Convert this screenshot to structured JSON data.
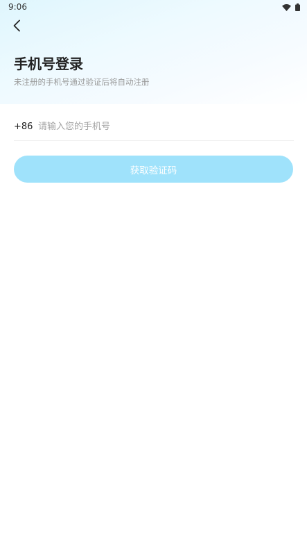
{
  "status_bar": {
    "time": "9:06",
    "icons": [
      "wifi-icon",
      "battery-icon"
    ]
  },
  "header": {
    "back_icon": "chevron-left-icon"
  },
  "login": {
    "title": "手机号登录",
    "subtitle": "未注册的手机号通过验证后将自动注册",
    "country_code": "+86",
    "phone_value": "",
    "phone_placeholder": "请输入您的手机号",
    "submit_label": "获取验证码"
  },
  "colors": {
    "button_bg": "#9fe2fb",
    "button_text": "#ffffff",
    "gradient_top": "#dff6fd",
    "title": "#222222",
    "subtitle": "#999999",
    "divider": "#eeeeee"
  }
}
